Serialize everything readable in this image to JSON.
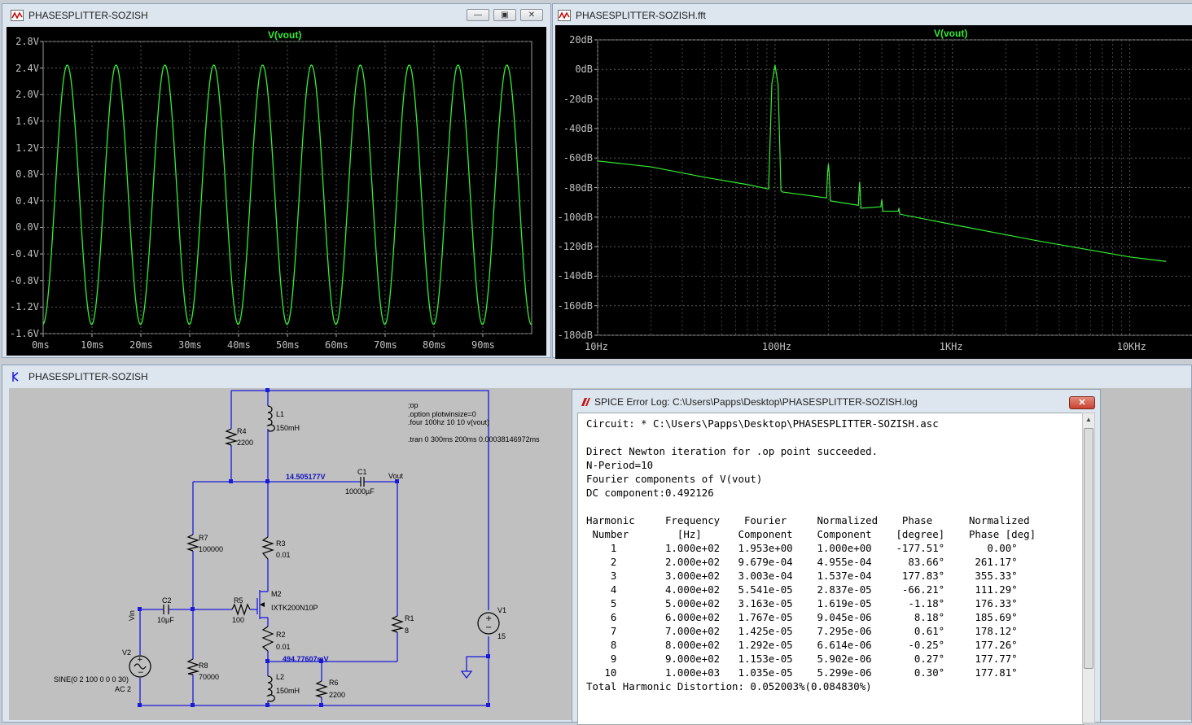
{
  "colors": {
    "trace": "#33ee33",
    "grid": "#5a5a5a",
    "plot_bg": "#000000",
    "wire": "#1a1adb",
    "node_label": "#1010c0",
    "desktop": "#c8cdd4"
  },
  "transient_window": {
    "title": "PHASESPLITTER-SOZISH",
    "icon": "waveform-icon",
    "buttons": {
      "minimize": "minimize-icon",
      "maximize": "maximize-icon",
      "close": "close-icon"
    }
  },
  "fft_window": {
    "title": "PHASESPLITTER-SOZISH.fft",
    "icon": "waveform-icon"
  },
  "schematic_window": {
    "title": "PHASESPLITTER-SOZISH",
    "icon": "schematic-icon",
    "labels": {
      "r4": "R4",
      "r4_val": "2200",
      "l1": "L1",
      "l1_val": "150mH",
      "r7": "R7",
      "r7_val": "100000",
      "r3": "R3",
      "r3_val": "0.01",
      "c1": "C1",
      "c1_val": "10000µF",
      "vout": "Vout",
      "node_v1": "14.505177V",
      "c2": "C2",
      "c2_val": "10µF",
      "vin": "Vin",
      "r5": "R5",
      "r5_val": "100",
      "m2": "M2",
      "m2_val": "IXTK200N10P",
      "r2": "R2",
      "r2_val": "0.01",
      "node_v2": "494.77607mV",
      "r1": "R1",
      "r1_val": "8",
      "v1": "V1",
      "v1_val": "15",
      "v2": "V2",
      "v2_val1": "SINE(0 2 100 0 0 0 30)",
      "v2_val2": "AC 2",
      "r8": "R8",
      "r8_val": "70000",
      "l2": "L2",
      "l2_val": "150mH",
      "r6": "R6",
      "r6_val": "2200"
    },
    "directives": [
      ";op",
      ".option plotwinsize=0",
      ".four 100hz 10 10 v(vout)",
      "",
      ".tran 0 300ms 200ms 0.00038146972ms"
    ]
  },
  "error_log": {
    "title": "SPICE Error Log: C:\\Users\\Papps\\Desktop\\PHASESPLITTER-SOZISH.log",
    "icon": "ltspice-icon",
    "lines": [
      "Circuit: * C:\\Users\\Papps\\Desktop\\PHASESPLITTER-SOZISH.asc",
      "",
      "Direct Newton iteration for .op point succeeded.",
      "N-Period=10",
      "Fourier components of V(vout)",
      "DC component:0.492126",
      "",
      "Harmonic     Frequency    Fourier     Normalized    Phase      Normalized",
      " Number        [Hz]      Component    Component    [degree]    Phase [deg]",
      "    1        1.000e+02   1.953e+00    1.000e+00    -177.51°       0.00°",
      "    2        2.000e+02   9.679e-04    4.955e-04      83.66°     261.17°",
      "    3        3.000e+02   3.003e-04    1.537e-04     177.83°     355.33°",
      "    4        4.000e+02   5.541e-05    2.837e-05     -66.21°     111.29°",
      "    5        5.000e+02   3.163e-05    1.619e-05      -1.18°     176.33°",
      "    6        6.000e+02   1.767e-05    9.045e-06       8.18°     185.69°",
      "    7        7.000e+02   1.425e-05    7.295e-06       0.61°     178.12°",
      "    8        8.000e+02   1.292e-05    6.614e-06      -0.25°     177.26°",
      "    9        9.000e+02   1.153e-05    5.902e-06       0.27°     177.77°",
      "   10        1.000e+03   1.035e-05    5.299e-06       0.30°     177.81°",
      "Total Harmonic Distortion: 0.052003%(0.084830%)"
    ]
  },
  "chart_data": [
    {
      "type": "line",
      "title": "V(vout)",
      "xlabel": "",
      "ylabel": "",
      "x_ticks": [
        "0ms",
        "10ms",
        "20ms",
        "30ms",
        "40ms",
        "50ms",
        "60ms",
        "70ms",
        "80ms",
        "90ms"
      ],
      "y_ticks": [
        "2.8V",
        "2.4V",
        "2.0V",
        "1.6V",
        "1.2V",
        "0.8V",
        "0.4V",
        "0.0V",
        "-0.4V",
        "-0.8V",
        "-1.2V",
        "-1.6V"
      ],
      "xlim": [
        0,
        100
      ],
      "ylim": [
        -1.6,
        2.8
      ],
      "grid": true,
      "series": [
        {
          "name": "V(vout)",
          "frequency_hz": 100,
          "dc": 0.492,
          "amplitude": 1.953,
          "phase_deg": -177.51
        }
      ]
    },
    {
      "type": "line",
      "title": "V(vout)",
      "xlabel": "",
      "ylabel": "",
      "x_scale": "log",
      "x_ticks": [
        "10Hz",
        "100Hz",
        "1KHz",
        "10KHz"
      ],
      "y_ticks": [
        "20dB",
        "0dB",
        "-20dB",
        "-40dB",
        "-60dB",
        "-80dB",
        "-100dB",
        "-120dB",
        "-140dB",
        "-160dB",
        "-180dB"
      ],
      "xlim": [
        10,
        16000
      ],
      "ylim": [
        -180,
        20
      ],
      "grid": true,
      "series": [
        {
          "name": "V(vout)",
          "points": [
            [
              10,
              -62
            ],
            [
              20,
              -66
            ],
            [
              40,
              -73
            ],
            [
              70,
              -78
            ],
            [
              92,
              -81
            ],
            [
              94,
              -45
            ],
            [
              96,
              -10
            ],
            [
              100,
              3
            ],
            [
              104,
              -10
            ],
            [
              106,
              -45
            ],
            [
              108,
              -82
            ],
            [
              110,
              -83
            ],
            [
              195,
              -87
            ],
            [
              198,
              -70
            ],
            [
              200,
              -64
            ],
            [
              202,
              -70
            ],
            [
              205,
              -89
            ],
            [
              295,
              -92
            ],
            [
              298,
              -82
            ],
            [
              300,
              -76
            ],
            [
              302,
              -82
            ],
            [
              305,
              -94
            ],
            [
              395,
              -93
            ],
            [
              400,
              -88
            ],
            [
              405,
              -96
            ],
            [
              495,
              -96
            ],
            [
              500,
              -94
            ],
            [
              505,
              -98
            ],
            [
              1000,
              -105
            ],
            [
              3000,
              -116
            ],
            [
              10000,
              -127
            ],
            [
              16000,
              -130
            ]
          ]
        }
      ]
    }
  ]
}
